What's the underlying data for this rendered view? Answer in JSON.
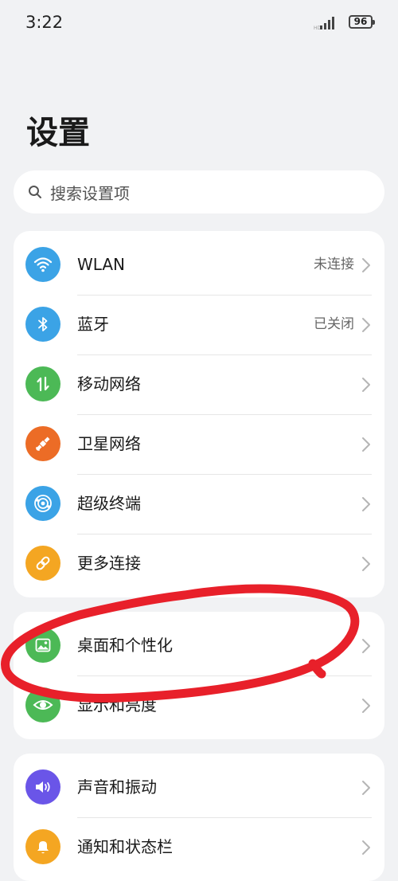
{
  "status_bar": {
    "time": "3:22",
    "battery": "96"
  },
  "page_title": "设置",
  "search": {
    "placeholder": "搜索设置项"
  },
  "groups": [
    {
      "items": [
        {
          "label": "WLAN",
          "value": "未连接",
          "icon": "wifi-icon",
          "color": "#3ba3e6"
        },
        {
          "label": "蓝牙",
          "value": "已关闭",
          "icon": "bluetooth-icon",
          "color": "#3ba3e6"
        },
        {
          "label": "移动网络",
          "value": "",
          "icon": "mobile-data-icon",
          "color": "#4cb956"
        },
        {
          "label": "卫星网络",
          "value": "",
          "icon": "satellite-icon",
          "color": "#ec6c26"
        },
        {
          "label": "超级终端",
          "value": "",
          "icon": "super-device-icon",
          "color": "#3ba3e6"
        },
        {
          "label": "更多连接",
          "value": "",
          "icon": "link-icon",
          "color": "#f4a622"
        }
      ]
    },
    {
      "items": [
        {
          "label": "桌面和个性化",
          "value": "",
          "icon": "wallpaper-icon",
          "color": "#4cb956"
        },
        {
          "label": "显示和亮度",
          "value": "",
          "icon": "eye-icon",
          "color": "#4cb956"
        }
      ]
    },
    {
      "items": [
        {
          "label": "声音和振动",
          "value": "",
          "icon": "speaker-icon",
          "color": "#6a55e8"
        },
        {
          "label": "通知和状态栏",
          "value": "",
          "icon": "bell-icon",
          "color": "#f4a622"
        }
      ]
    }
  ],
  "annotation_color": "#e8202a"
}
